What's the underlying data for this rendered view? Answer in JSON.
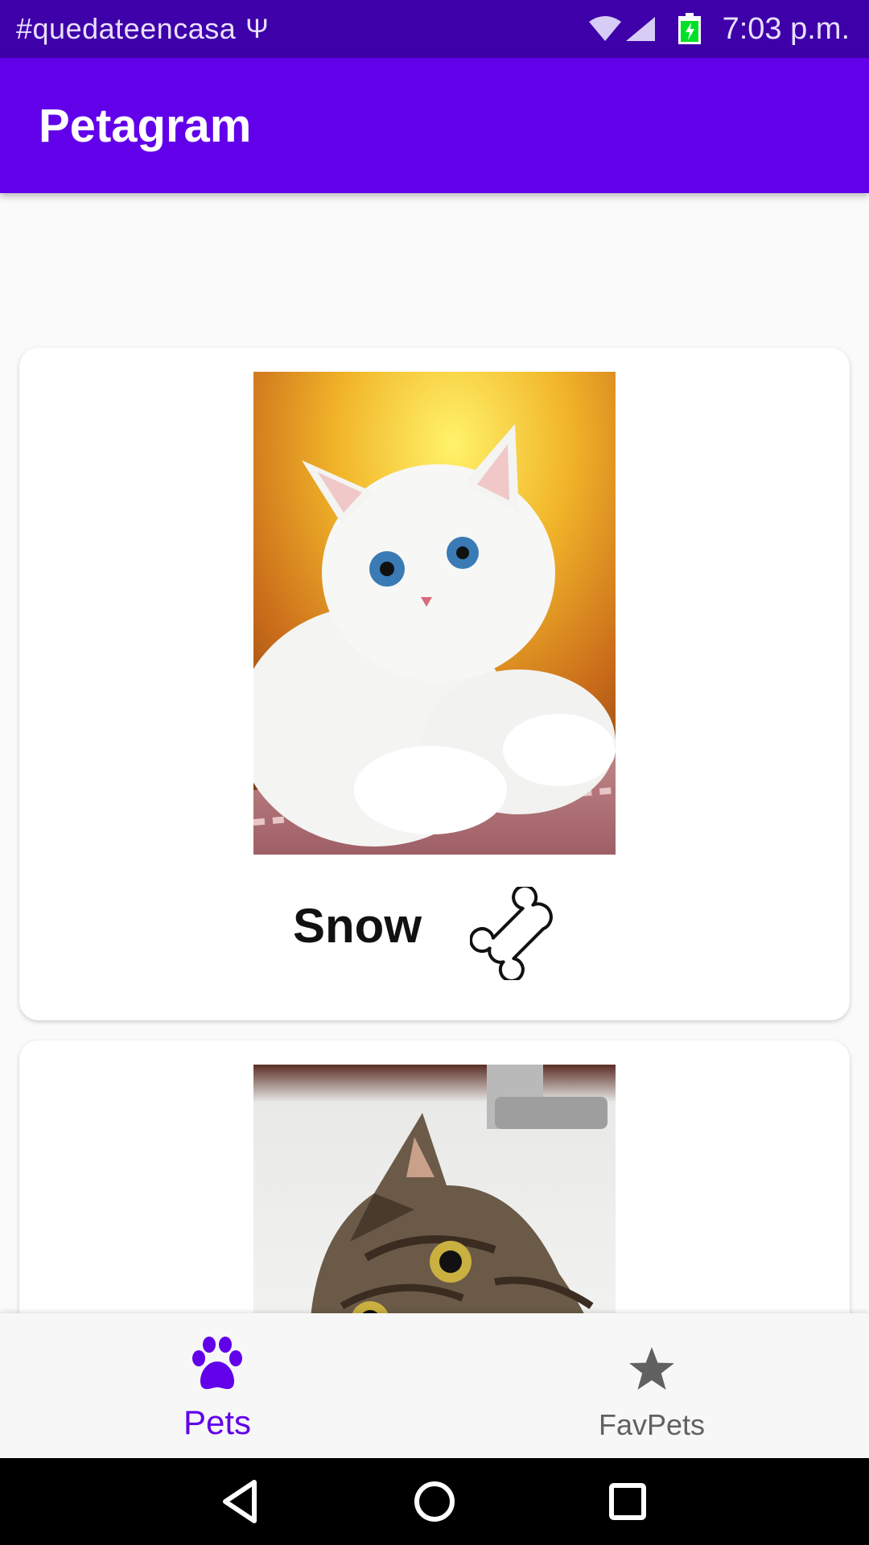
{
  "status_bar": {
    "hashtag": "#quedateencasa",
    "usb_glyph": "Ψ",
    "time": "7:03 p.m.",
    "icons": [
      "wifi-icon",
      "cell-signal-icon",
      "battery-charging-icon"
    ]
  },
  "app_bar": {
    "title": "Petagram",
    "color": "#6200ea",
    "status_color": "#3e00a8"
  },
  "pets": [
    {
      "name": "Snow",
      "photo": "white fluffy cat",
      "action_icon": "bone-icon"
    },
    {
      "name": "",
      "photo": "tabby cat in sink"
    }
  ],
  "bottom_nav": {
    "items": [
      {
        "label": "Pets",
        "icon": "paw-icon",
        "selected": true,
        "color": "#6200ea"
      },
      {
        "label": "FavPets",
        "icon": "star-icon",
        "selected": false,
        "color": "#616161"
      }
    ]
  },
  "system_nav": {
    "icons": [
      "back-icon",
      "home-icon",
      "recents-icon"
    ]
  }
}
